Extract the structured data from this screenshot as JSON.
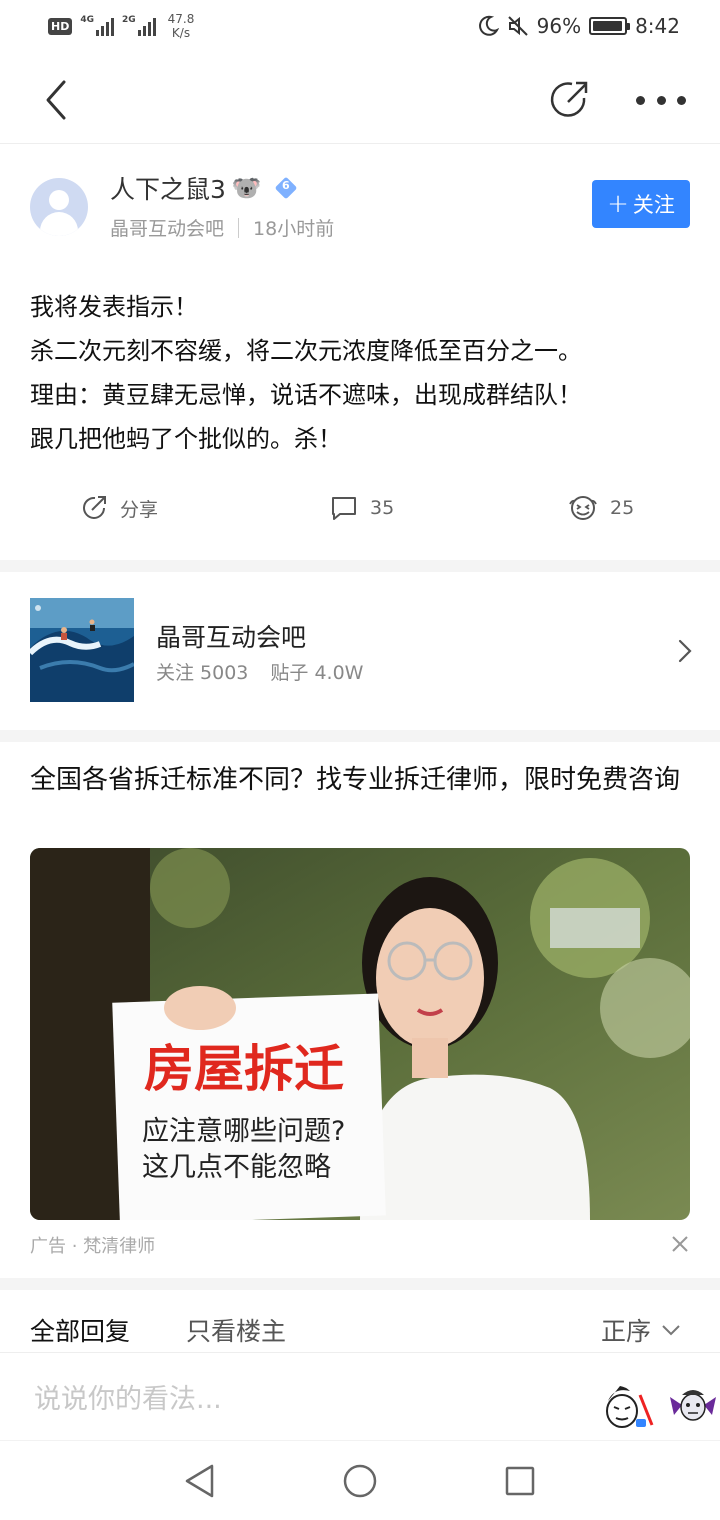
{
  "status_bar": {
    "hd": "HD",
    "net1": "4G",
    "net2": "2G",
    "speed_value": "47.8",
    "speed_unit": "K/s",
    "battery": "96%",
    "battery_level": 0.96,
    "time": "8:42"
  },
  "post": {
    "username": "人下之鼠3",
    "emoji": "🐨",
    "level": "6",
    "forum": "晶哥互动会吧",
    "time_ago": "18小时前",
    "follow_label": "关注",
    "body_lines": [
      "我将发表指示！",
      "杀二次元刻不容缓，将二次元浓度降低至百分之一。",
      "理由：黄豆肆无忌惮，说话不遮味，出现成群结队！",
      "跟几把他蚂了个批似的。杀！"
    ],
    "share_label": "分享",
    "comment_count": "35",
    "like_count": "25"
  },
  "forum_card": {
    "name": "晶哥互动会吧",
    "followers": "关注 5003",
    "posts": "贴子 4.0W"
  },
  "ad": {
    "title": "全国各省拆迁标准不同？找专业拆迁律师，限时免费咨询",
    "image_headline": "房屋拆迁",
    "image_line1": "应注意哪些问题?",
    "image_line2": "这几点不能忽略",
    "source": "广告 · 梵清律师"
  },
  "replies": {
    "tab_all": "全部回复",
    "tab_op": "只看楼主",
    "sort": "正序"
  },
  "comment": {
    "placeholder": "说说你的看法..."
  },
  "colors": {
    "accent": "#3385ff",
    "ad_red": "#e0281e"
  }
}
